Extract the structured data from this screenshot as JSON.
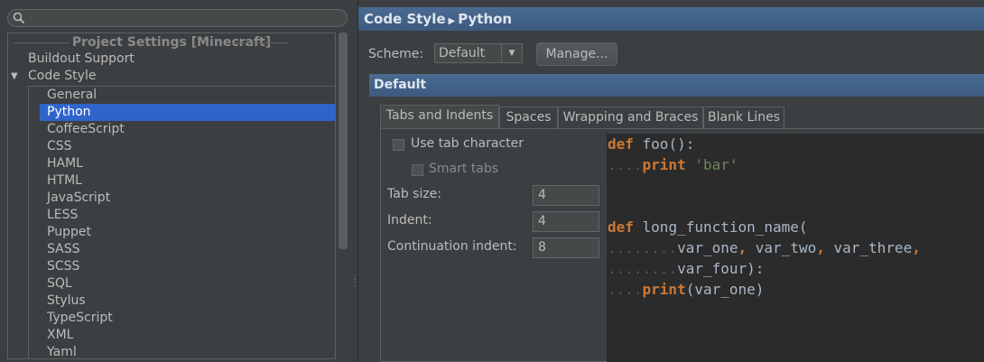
{
  "search": {
    "placeholder": ""
  },
  "tree": {
    "title": "Project Settings [Minecraft]",
    "buildout": "Buildout Support",
    "code_style": "Code Style",
    "children": [
      "General",
      "Python",
      "CoffeeScript",
      "CSS",
      "HAML",
      "HTML",
      "JavaScript",
      "LESS",
      "Puppet",
      "SASS",
      "SCSS",
      "SQL",
      "Stylus",
      "TypeScript",
      "XML",
      "Yaml"
    ],
    "selected": "Python"
  },
  "header": {
    "crumb1": "Code Style",
    "crumb2": "Python"
  },
  "scheme": {
    "label": "Scheme:",
    "value": "Default",
    "manage": "Manage..."
  },
  "section": {
    "title": "Default"
  },
  "tabs": [
    "Tabs and Indents",
    "Spaces",
    "Wrapping and Braces",
    "Blank Lines"
  ],
  "options": {
    "use_tab": "Use tab character",
    "smart_tabs": "Smart tabs",
    "tab_size_label": "Tab size:",
    "tab_size": "4",
    "indent_label": "Indent:",
    "indent": "4",
    "cont_label": "Continuation indent:",
    "cont": "8"
  },
  "code": {
    "l1_kw": "def",
    "l1_rest": " foo():",
    "l2_ws": "....",
    "l2_kw": "print",
    "l2_str": "'bar'",
    "l5_kw": "def",
    "l5_rest": " long_function_name(",
    "l6_ws": "........",
    "l6_a": "var_one",
    "l6_b": "var_two",
    "l6_c": "var_three",
    "l7_ws": "........",
    "l7_a": "var_four):",
    "l8_ws": "....",
    "l8_kw": "print",
    "l8_rest": "(var_one)"
  },
  "colors": {
    "selection": "#2f65ca",
    "header": "#4a6a92",
    "keyword": "#cc7832",
    "string": "#6a8759"
  }
}
